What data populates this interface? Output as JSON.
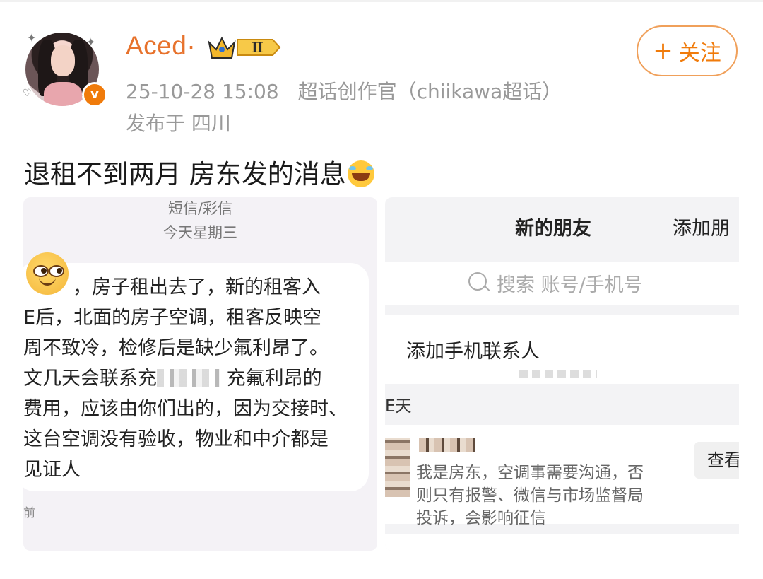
{
  "post": {
    "username": "Aced·",
    "level_badge": "Ⅱ",
    "timestamp": "25-10-28 15:08",
    "source_tag": "超话创作官（chiikawa超话）",
    "location": "发布于 四川",
    "follow_label": "关注",
    "follow_plus": "+",
    "verified_mark": "v",
    "text": "退租不到两月 房东发的消息"
  },
  "colors": {
    "username": "#e7722c",
    "follow": "#f07b0b",
    "meta": "#999999"
  },
  "icons": {
    "laugh": "laughing-with-tears-icon",
    "verified": "verified-v-icon",
    "crown": "crown-level-icon"
  },
  "sms_screenshot": {
    "header": "短信/彩信",
    "day": "今天星期三",
    "lines": [
      "，房子租出去了，新的租客入",
      "E后，北面的房子空调，租客反映空",
      "周不致冷，检修后是缺少氟利昂了。",
      "文几天会联系充",
      "费用，应该由你们出的，因为交接时、",
      "这台空调没有验收，物业和中介都是",
      "见证人"
    ],
    "line4_suffix": "充氟利昂的",
    "time_fragment": "前"
  },
  "wechat_screenshot": {
    "tab_new_friends": "新的朋友",
    "tab_add_friends": "添加朋",
    "search_placeholder": "搜索 账号/手机号",
    "add_contacts": "添加手机联系人",
    "section_label": "E天",
    "message_lines": [
      "我是房东，空调事需要沟通，否",
      "则只有报警、微信与市场监督局",
      "投诉，会影响征信"
    ],
    "view_button": "查看"
  }
}
